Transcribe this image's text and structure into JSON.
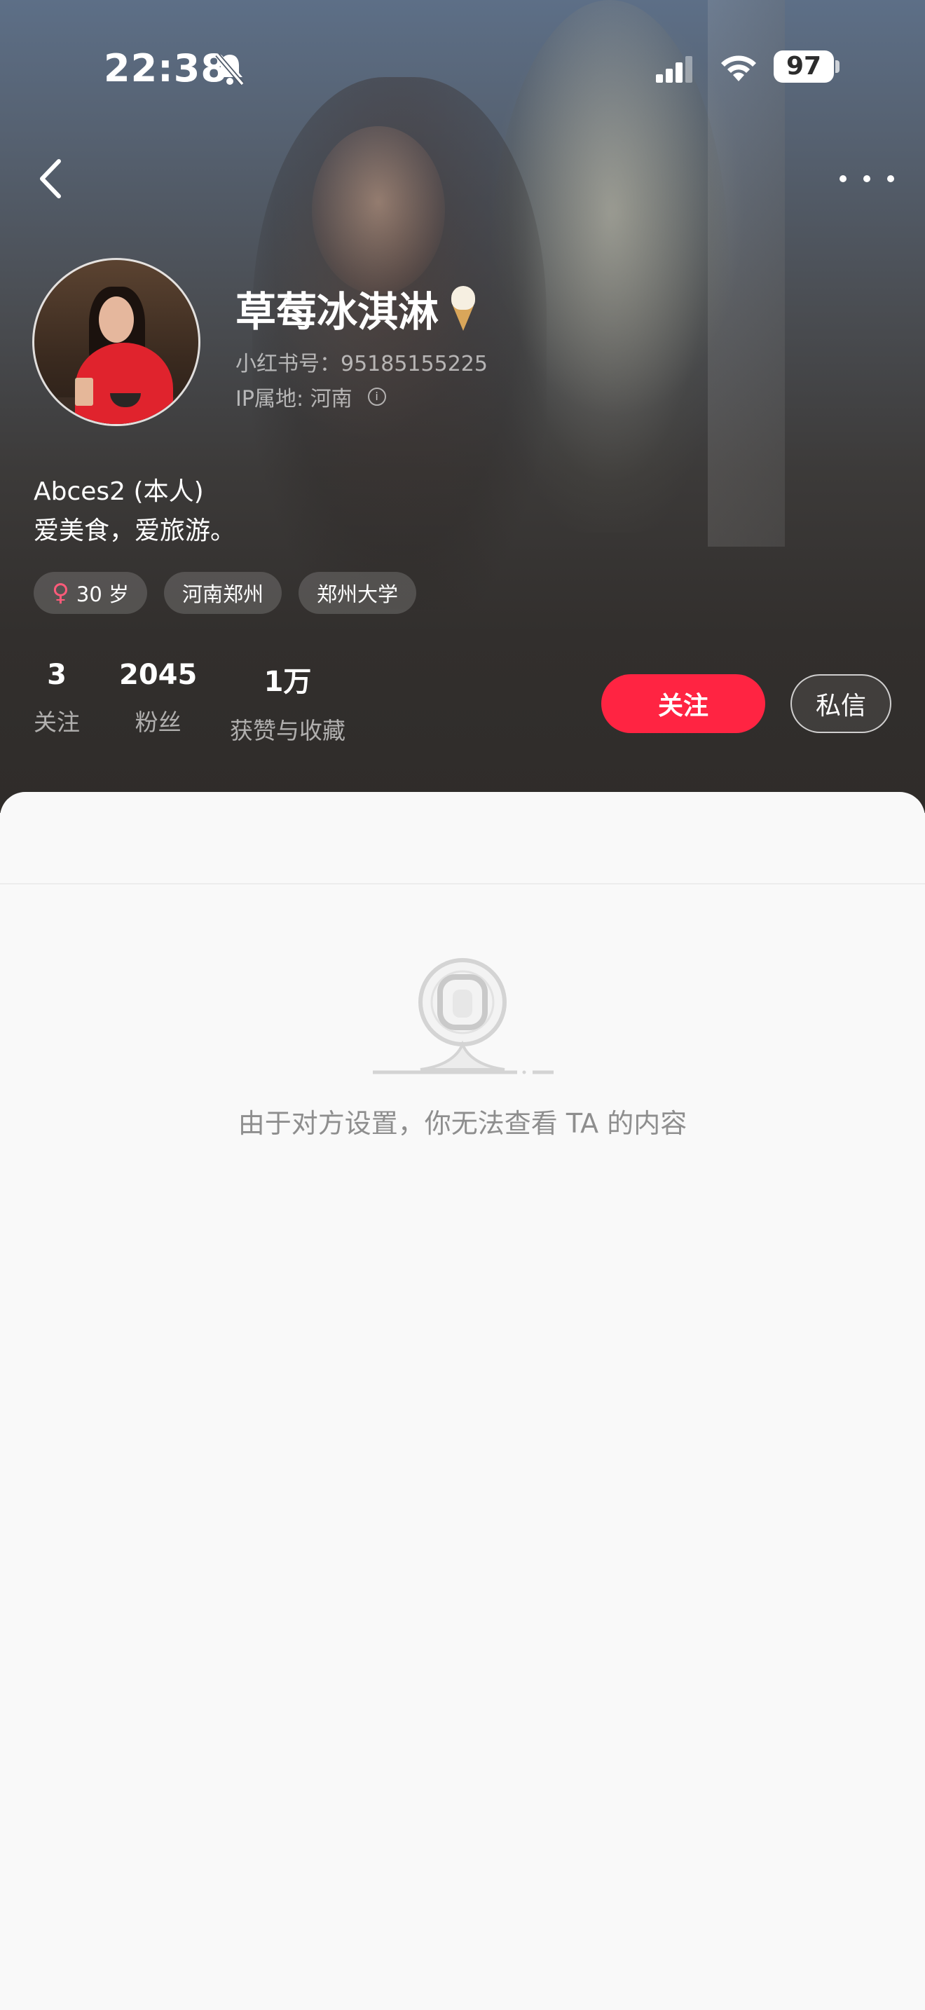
{
  "status_bar": {
    "time": "22:38",
    "battery": "97",
    "icons": [
      "bell-slash-icon",
      "signal-icon",
      "wifi-icon",
      "battery-icon"
    ]
  },
  "nav": {
    "icons": [
      "chevron-left-icon",
      "more-icon"
    ]
  },
  "profile": {
    "nickname": "草莓冰淇淋",
    "emoji_icon": "ice-cream-icon",
    "red_id": "小红书号：95185155225",
    "ip_location": "IP属地: 河南",
    "bio_line1": "Abces2 (本人)",
    "bio_line2": "爱美食，爱旅游。",
    "tags": {
      "age": "30 岁",
      "location": "河南郑州",
      "school": "郑州大学"
    },
    "gender_icon": "female-icon"
  },
  "stats": {
    "following_count": "3",
    "following_label": "关注",
    "fans_count": "2045",
    "fans_label": "粉丝",
    "likes_count": "1万",
    "likes_label": "获赞与收藏"
  },
  "actions": {
    "follow_label": "关注",
    "message_label": "私信"
  },
  "content": {
    "empty_message": "由于对方设置，你无法查看 TA 的内容"
  },
  "colors": {
    "accent": "#ff2442",
    "panel_bg": "#f9f9f9",
    "header_bg": "#322f2d"
  }
}
